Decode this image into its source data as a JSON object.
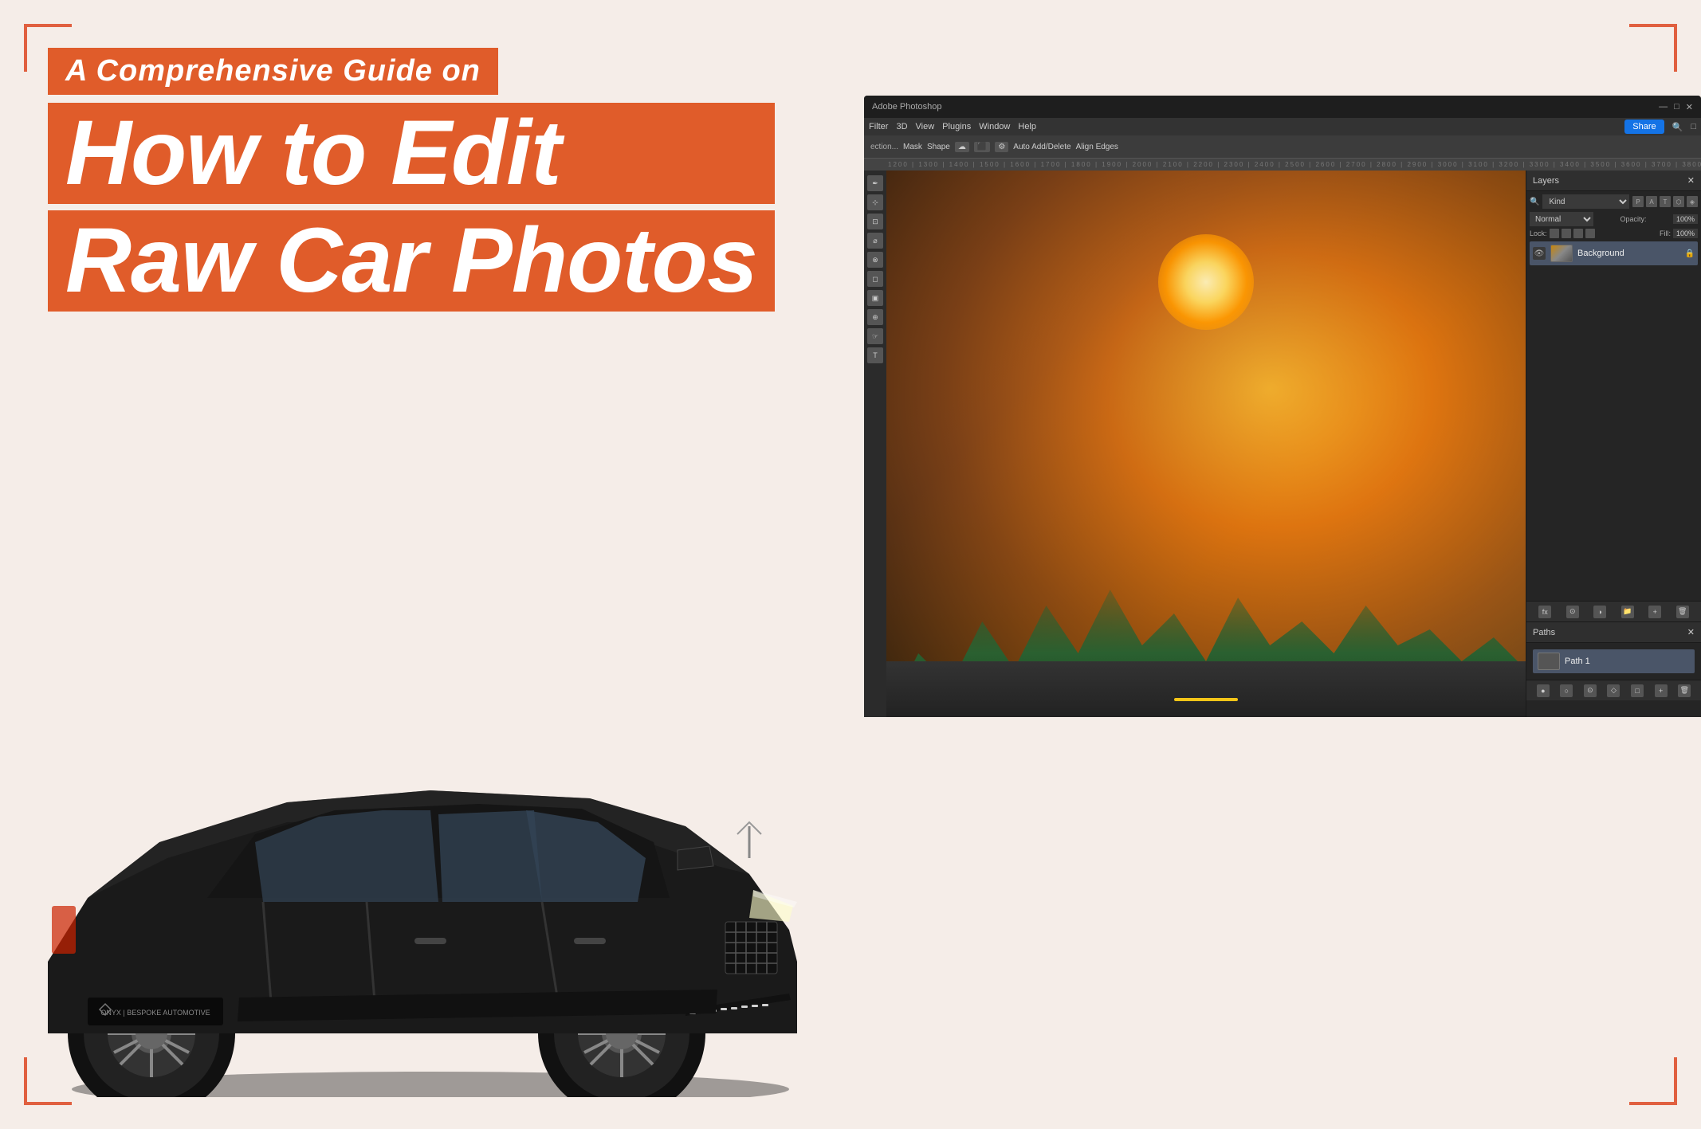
{
  "page": {
    "bg_color": "#f5ede8",
    "accent_color": "#e05c2a",
    "title": {
      "subtitle": "A Comprehensive Guide on",
      "line1": "How to Edit",
      "line2": "Raw Car Photos"
    },
    "photoshop": {
      "titlebar": {
        "title": "Adobe Photoshop",
        "controls": [
          "—",
          "□",
          "✕"
        ]
      },
      "menubar": {
        "items": [
          "Filter",
          "3D",
          "View",
          "Plugins",
          "Window",
          "Help"
        ]
      },
      "toolbar": {
        "items": [
          "ection...",
          "Mask",
          "Shape",
          "☁",
          "⬛",
          "⚙",
          "Auto Add/Delete",
          "Align Edges"
        ],
        "share_btn": "Share"
      },
      "layers_panel": {
        "header": "Layers",
        "kind_label": "Kind",
        "blend_mode": "Normal",
        "opacity_label": "Opacity:",
        "opacity_value": "100%",
        "fill_label": "Fill:",
        "fill_value": "100%",
        "lock_label": "Lock:",
        "layers": [
          {
            "name": "Background",
            "locked": true
          }
        ]
      },
      "paths_panel": {
        "header": "Paths",
        "paths": [
          {
            "name": "Path 1"
          }
        ]
      }
    },
    "car": {
      "brand": "ONYX | BESPOKE AUTOMOTIVE"
    },
    "corners": {
      "color": "#e06040"
    }
  }
}
